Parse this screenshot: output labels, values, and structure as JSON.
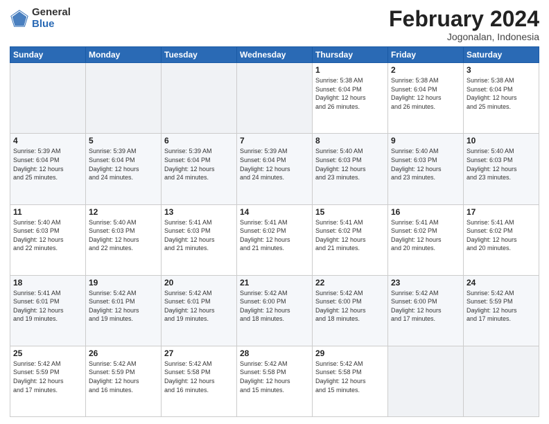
{
  "logo": {
    "general": "General",
    "blue": "Blue"
  },
  "title": "February 2024",
  "subtitle": "Jogonalan, Indonesia",
  "days_header": [
    "Sunday",
    "Monday",
    "Tuesday",
    "Wednesday",
    "Thursday",
    "Friday",
    "Saturday"
  ],
  "weeks": [
    [
      {
        "day": "",
        "info": ""
      },
      {
        "day": "",
        "info": ""
      },
      {
        "day": "",
        "info": ""
      },
      {
        "day": "",
        "info": ""
      },
      {
        "day": "1",
        "info": "Sunrise: 5:38 AM\nSunset: 6:04 PM\nDaylight: 12 hours\nand 26 minutes."
      },
      {
        "day": "2",
        "info": "Sunrise: 5:38 AM\nSunset: 6:04 PM\nDaylight: 12 hours\nand 26 minutes."
      },
      {
        "day": "3",
        "info": "Sunrise: 5:38 AM\nSunset: 6:04 PM\nDaylight: 12 hours\nand 25 minutes."
      }
    ],
    [
      {
        "day": "4",
        "info": "Sunrise: 5:39 AM\nSunset: 6:04 PM\nDaylight: 12 hours\nand 25 minutes."
      },
      {
        "day": "5",
        "info": "Sunrise: 5:39 AM\nSunset: 6:04 PM\nDaylight: 12 hours\nand 24 minutes."
      },
      {
        "day": "6",
        "info": "Sunrise: 5:39 AM\nSunset: 6:04 PM\nDaylight: 12 hours\nand 24 minutes."
      },
      {
        "day": "7",
        "info": "Sunrise: 5:39 AM\nSunset: 6:04 PM\nDaylight: 12 hours\nand 24 minutes."
      },
      {
        "day": "8",
        "info": "Sunrise: 5:40 AM\nSunset: 6:03 PM\nDaylight: 12 hours\nand 23 minutes."
      },
      {
        "day": "9",
        "info": "Sunrise: 5:40 AM\nSunset: 6:03 PM\nDaylight: 12 hours\nand 23 minutes."
      },
      {
        "day": "10",
        "info": "Sunrise: 5:40 AM\nSunset: 6:03 PM\nDaylight: 12 hours\nand 23 minutes."
      }
    ],
    [
      {
        "day": "11",
        "info": "Sunrise: 5:40 AM\nSunset: 6:03 PM\nDaylight: 12 hours\nand 22 minutes."
      },
      {
        "day": "12",
        "info": "Sunrise: 5:40 AM\nSunset: 6:03 PM\nDaylight: 12 hours\nand 22 minutes."
      },
      {
        "day": "13",
        "info": "Sunrise: 5:41 AM\nSunset: 6:03 PM\nDaylight: 12 hours\nand 21 minutes."
      },
      {
        "day": "14",
        "info": "Sunrise: 5:41 AM\nSunset: 6:02 PM\nDaylight: 12 hours\nand 21 minutes."
      },
      {
        "day": "15",
        "info": "Sunrise: 5:41 AM\nSunset: 6:02 PM\nDaylight: 12 hours\nand 21 minutes."
      },
      {
        "day": "16",
        "info": "Sunrise: 5:41 AM\nSunset: 6:02 PM\nDaylight: 12 hours\nand 20 minutes."
      },
      {
        "day": "17",
        "info": "Sunrise: 5:41 AM\nSunset: 6:02 PM\nDaylight: 12 hours\nand 20 minutes."
      }
    ],
    [
      {
        "day": "18",
        "info": "Sunrise: 5:41 AM\nSunset: 6:01 PM\nDaylight: 12 hours\nand 19 minutes."
      },
      {
        "day": "19",
        "info": "Sunrise: 5:42 AM\nSunset: 6:01 PM\nDaylight: 12 hours\nand 19 minutes."
      },
      {
        "day": "20",
        "info": "Sunrise: 5:42 AM\nSunset: 6:01 PM\nDaylight: 12 hours\nand 19 minutes."
      },
      {
        "day": "21",
        "info": "Sunrise: 5:42 AM\nSunset: 6:00 PM\nDaylight: 12 hours\nand 18 minutes."
      },
      {
        "day": "22",
        "info": "Sunrise: 5:42 AM\nSunset: 6:00 PM\nDaylight: 12 hours\nand 18 minutes."
      },
      {
        "day": "23",
        "info": "Sunrise: 5:42 AM\nSunset: 6:00 PM\nDaylight: 12 hours\nand 17 minutes."
      },
      {
        "day": "24",
        "info": "Sunrise: 5:42 AM\nSunset: 5:59 PM\nDaylight: 12 hours\nand 17 minutes."
      }
    ],
    [
      {
        "day": "25",
        "info": "Sunrise: 5:42 AM\nSunset: 5:59 PM\nDaylight: 12 hours\nand 17 minutes."
      },
      {
        "day": "26",
        "info": "Sunrise: 5:42 AM\nSunset: 5:59 PM\nDaylight: 12 hours\nand 16 minutes."
      },
      {
        "day": "27",
        "info": "Sunrise: 5:42 AM\nSunset: 5:58 PM\nDaylight: 12 hours\nand 16 minutes."
      },
      {
        "day": "28",
        "info": "Sunrise: 5:42 AM\nSunset: 5:58 PM\nDaylight: 12 hours\nand 15 minutes."
      },
      {
        "day": "29",
        "info": "Sunrise: 5:42 AM\nSunset: 5:58 PM\nDaylight: 12 hours\nand 15 minutes."
      },
      {
        "day": "",
        "info": ""
      },
      {
        "day": "",
        "info": ""
      }
    ]
  ]
}
